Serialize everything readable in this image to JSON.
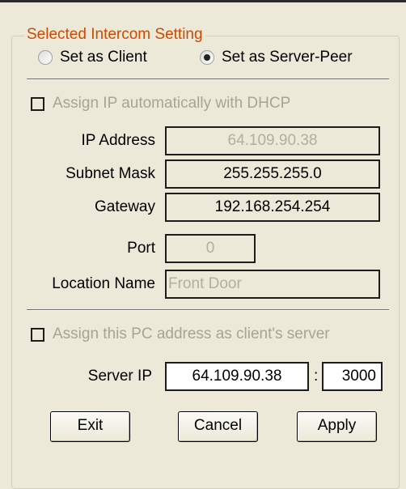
{
  "group": {
    "title": "Selected Intercom Setting"
  },
  "mode": {
    "client_label": "Set as Client",
    "server_label": "Set as Server-Peer",
    "selected": "server"
  },
  "dhcp": {
    "label": "Assign IP automatically with  DHCP",
    "checked": false
  },
  "network": {
    "ip_label": "IP Address",
    "ip_value": "64.109.90.38",
    "subnet_label": "Subnet Mask",
    "subnet_value": "255.255.255.0",
    "gateway_label": "Gateway",
    "gateway_value": "192.168.254.254",
    "port_label": "Port",
    "port_value": "0",
    "location_label": "Location Name",
    "location_value": "Front Door"
  },
  "client_server": {
    "label": "Assign this PC address as client's server",
    "checked": false
  },
  "server": {
    "ip_label": "Server IP",
    "ip_value": "64.109.90.38",
    "separator": ":",
    "port_value": "3000"
  },
  "buttons": {
    "exit": "Exit",
    "cancel": "Cancel",
    "apply": "Apply"
  }
}
